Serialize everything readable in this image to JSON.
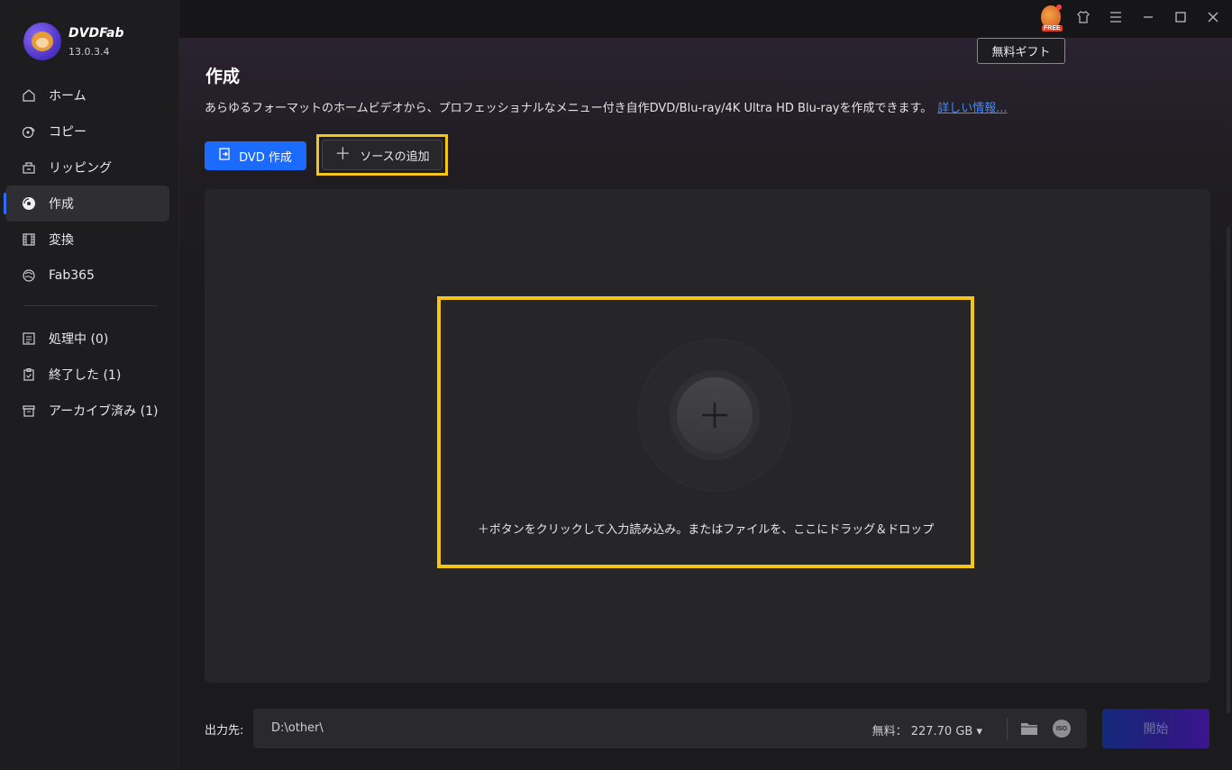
{
  "app": {
    "name": "DVDFab",
    "version": "13.0.3.4"
  },
  "sidebar": {
    "items": [
      {
        "label": "ホーム",
        "icon": "home-icon"
      },
      {
        "label": "コピー",
        "icon": "copy-icon"
      },
      {
        "label": "リッピング",
        "icon": "ripping-icon"
      },
      {
        "label": "作成",
        "icon": "create-disc-icon",
        "active": true
      },
      {
        "label": "変換",
        "icon": "film-convert-icon"
      },
      {
        "label": "Fab365",
        "icon": "fab365-icon"
      }
    ],
    "tasks": [
      {
        "label": "処理中 (0)",
        "icon": "processing-list-icon"
      },
      {
        "label": "終了した (1)",
        "icon": "finished-clipboard-icon"
      },
      {
        "label": "アーカイブ済み (1)",
        "icon": "archive-box-icon"
      }
    ]
  },
  "topbar": {
    "free_badge": "FREE",
    "tooltip": "無料ギフト"
  },
  "main": {
    "title": "作成",
    "description": "あらゆるフォーマットのホームビデオから、プロフェッショナルなメニュー付き自作DVD/Blu-ray/4K Ultra HD Blu-rayを作成できます。",
    "more_link": "詳しい情報...",
    "dvd_button": "DVD 作成",
    "add_source_button": "ソースの追加",
    "drop_hint": "＋ボタンをクリックして入力読み込み。またはファイルを、ここにドラッグ＆ドロップ"
  },
  "output": {
    "label": "出力先:",
    "path": "D:\\other\\",
    "free_space": "無料：  227.70 GB",
    "iso_label": "ISO",
    "start_button": "開始"
  },
  "colors": {
    "accent": "#1b6bff",
    "highlight": "#f5c518",
    "link": "#3f8cff"
  }
}
